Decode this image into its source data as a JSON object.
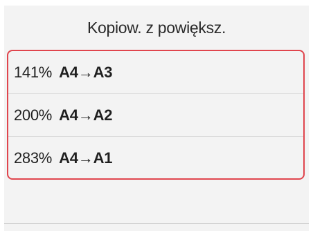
{
  "header": {
    "title": "Kopiow. z powiększ."
  },
  "options": [
    {
      "percent": "141%",
      "size": "A4→A3"
    },
    {
      "percent": "200%",
      "size": "A4→A2"
    },
    {
      "percent": "283%",
      "size": "A4→A1"
    }
  ],
  "colors": {
    "highlight_border": "#e0454d",
    "background": "#f3f3f3"
  }
}
